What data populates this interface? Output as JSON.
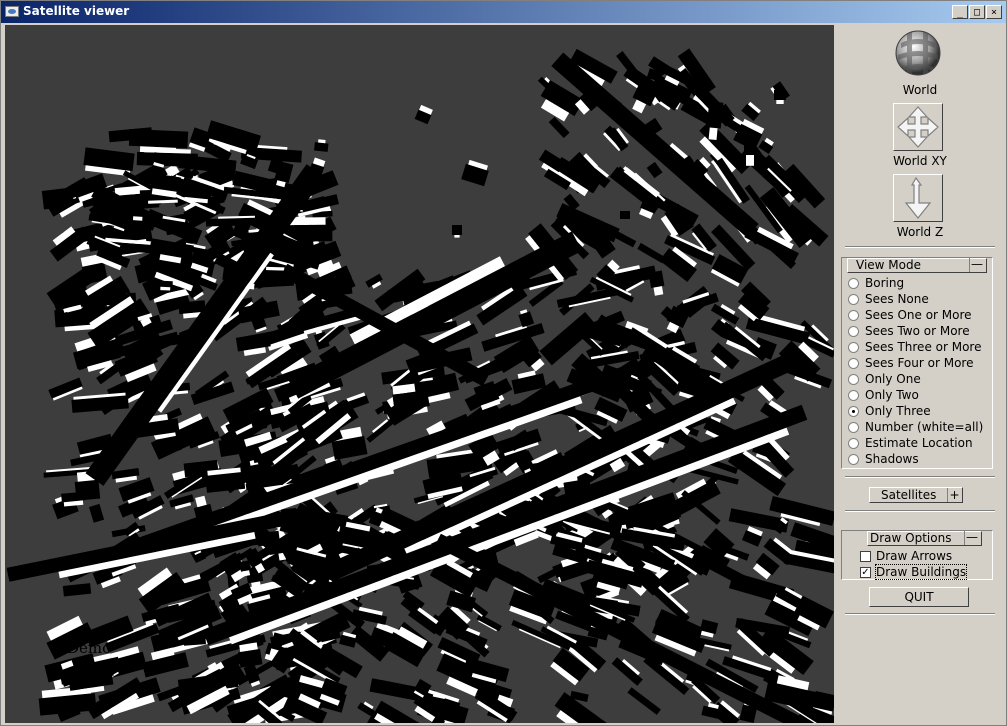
{
  "window": {
    "title": "Satellite viewer"
  },
  "title_buttons": {
    "minimize": "_",
    "maximize": "□",
    "close": "×"
  },
  "viewport": {
    "watermark": "Demo"
  },
  "tools": [
    {
      "label": "World",
      "icon": "globe-icon"
    },
    {
      "label": "World XY",
      "icon": "move-arrows-icon"
    },
    {
      "label": "World Z",
      "icon": "vertical-arrow-icon"
    }
  ],
  "view_mode": {
    "title": "View Mode",
    "toggle": "—",
    "selected": "Only Three",
    "options": [
      "Boring",
      "Sees None",
      "Sees One or More",
      "Sees Two or More",
      "Sees Three or More",
      "Sees Four or More",
      "Only One",
      "Only Two",
      "Only Three",
      "Number (white=all)",
      "Estimate Location",
      "Shadows"
    ]
  },
  "satellites": {
    "title": "Satellites",
    "toggle": "+"
  },
  "draw_options": {
    "title": "Draw Options",
    "toggle": "—",
    "items": [
      {
        "label": "Draw Arrows",
        "checked": false
      },
      {
        "label": "Draw Buildings",
        "checked": true
      }
    ]
  },
  "quit": {
    "label": "QUIT"
  }
}
